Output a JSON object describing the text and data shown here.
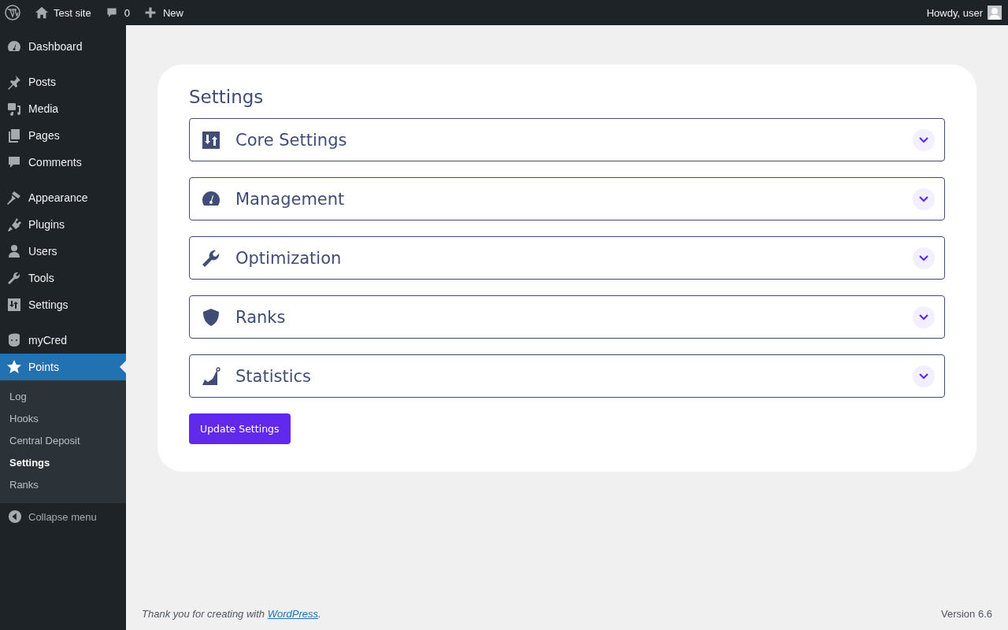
{
  "admin_bar": {
    "site_name": "Test site",
    "comments_count": "0",
    "new_label": "New",
    "greeting": "Howdy, user"
  },
  "sidebar": {
    "groups": [
      {
        "items": [
          {
            "label": "Dashboard",
            "selected": false
          }
        ]
      },
      {
        "items": [
          {
            "label": "Posts",
            "selected": false
          },
          {
            "label": "Media",
            "selected": false
          },
          {
            "label": "Pages",
            "selected": false
          },
          {
            "label": "Comments",
            "selected": false
          }
        ]
      },
      {
        "items": [
          {
            "label": "Appearance",
            "selected": false
          },
          {
            "label": "Plugins",
            "selected": false
          },
          {
            "label": "Users",
            "selected": false
          },
          {
            "label": "Tools",
            "selected": false
          },
          {
            "label": "Settings",
            "selected": false
          }
        ]
      },
      {
        "items": [
          {
            "label": "myCred",
            "selected": false
          },
          {
            "label": "Points",
            "selected": true,
            "children": [
              {
                "label": "Log",
                "selected": false
              },
              {
                "label": "Hooks",
                "selected": false
              },
              {
                "label": "Central Deposit",
                "selected": false
              },
              {
                "label": "Settings",
                "selected": true
              },
              {
                "label": "Ranks",
                "selected": false
              }
            ]
          }
        ]
      }
    ],
    "collapse_label": "Collapse menu"
  },
  "settings": {
    "title": "Settings",
    "sections": [
      {
        "label": "Core Settings",
        "expanded": false
      },
      {
        "label": "Management",
        "expanded": false
      },
      {
        "label": "Optimization",
        "expanded": false
      },
      {
        "label": "Ranks",
        "expanded": false
      },
      {
        "label": "Statistics",
        "expanded": false
      }
    ],
    "submit_label": "Update Settings"
  },
  "footer": {
    "thanks_prefix": "Thank you for creating with ",
    "link": "WordPress",
    "thanks_suffix": ".",
    "version": "Version 6.6"
  }
}
